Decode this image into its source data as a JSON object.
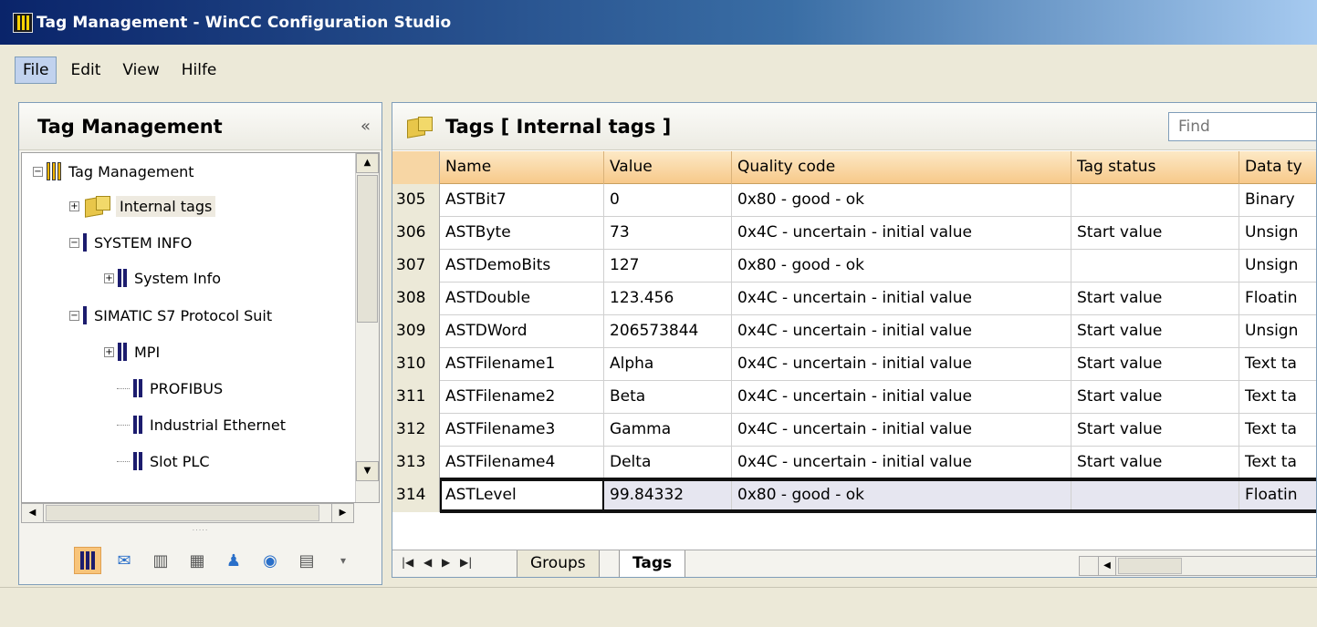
{
  "window": {
    "title": "Tag Management - WinCC Configuration Studio"
  },
  "menu": {
    "items": [
      "File",
      "Edit",
      "View",
      "Hilfe"
    ]
  },
  "nav": {
    "title": "Tag Management",
    "collapse_glyph": "«",
    "tree": [
      {
        "label": "Tag Management",
        "icon": "tag-management-icon"
      },
      {
        "label": "Internal tags",
        "icon": "internal-tags-cube-icon"
      },
      {
        "label": "SYSTEM INFO",
        "icon": "driver-icon"
      },
      {
        "label": "System Info",
        "icon": "connection-icon"
      },
      {
        "label": "SIMATIC S7 Protocol Suit",
        "icon": "driver-icon"
      },
      {
        "label": "MPI",
        "icon": "connection-icon"
      },
      {
        "label": "PROFIBUS",
        "icon": "connection-icon"
      },
      {
        "label": "Industrial Ethernet",
        "icon": "connection-icon"
      },
      {
        "label": "Slot PLC",
        "icon": "connection-icon"
      }
    ],
    "grip": "....."
  },
  "main": {
    "title": "Tags [ Internal tags ]",
    "find_placeholder": "Find",
    "columns": [
      "Name",
      "Value",
      "Quality code",
      "Tag status",
      "Data ty"
    ],
    "rows": [
      {
        "num": "305",
        "name": "ASTBit7",
        "value": "0",
        "quality": "0x80 - good - ok",
        "status": "",
        "type": "Binary"
      },
      {
        "num": "306",
        "name": "ASTByte",
        "value": "73",
        "quality": "0x4C - uncertain - initial value",
        "status": "Start value",
        "type": "Unsign"
      },
      {
        "num": "307",
        "name": "ASTDemoBits",
        "value": "127",
        "quality": "0x80 - good - ok",
        "status": "",
        "type": "Unsign"
      },
      {
        "num": "308",
        "name": "ASTDouble",
        "value": "123.456",
        "quality": "0x4C - uncertain - initial value",
        "status": "Start value",
        "type": "Floatin"
      },
      {
        "num": "309",
        "name": "ASTDWord",
        "value": "206573844",
        "quality": "0x4C - uncertain - initial value",
        "status": "Start value",
        "type": "Unsign"
      },
      {
        "num": "310",
        "name": "ASTFilename1",
        "value": "Alpha",
        "quality": "0x4C - uncertain - initial value",
        "status": "Start value",
        "type": "Text ta"
      },
      {
        "num": "311",
        "name": "ASTFilename2",
        "value": "Beta",
        "quality": "0x4C - uncertain - initial value",
        "status": "Start value",
        "type": "Text ta"
      },
      {
        "num": "312",
        "name": "ASTFilename3",
        "value": "Gamma",
        "quality": "0x4C - uncertain - initial value",
        "status": "Start value",
        "type": "Text ta"
      },
      {
        "num": "313",
        "name": "ASTFilename4",
        "value": "Delta",
        "quality": "0x4C - uncertain - initial value",
        "status": "Start value",
        "type": "Text ta"
      },
      {
        "num": "314",
        "name": "ASTLevel",
        "value": "99.84332",
        "quality": "0x80 - good - ok",
        "status": "",
        "type": "Floatin"
      }
    ],
    "selected_row": "314",
    "tabs": [
      "Groups",
      "Tags"
    ],
    "active_tab": "Tags"
  },
  "colors": {
    "title_bar": "#0a246a",
    "header_row": "#f7c98a",
    "active_menu": "#c1d2ee"
  }
}
